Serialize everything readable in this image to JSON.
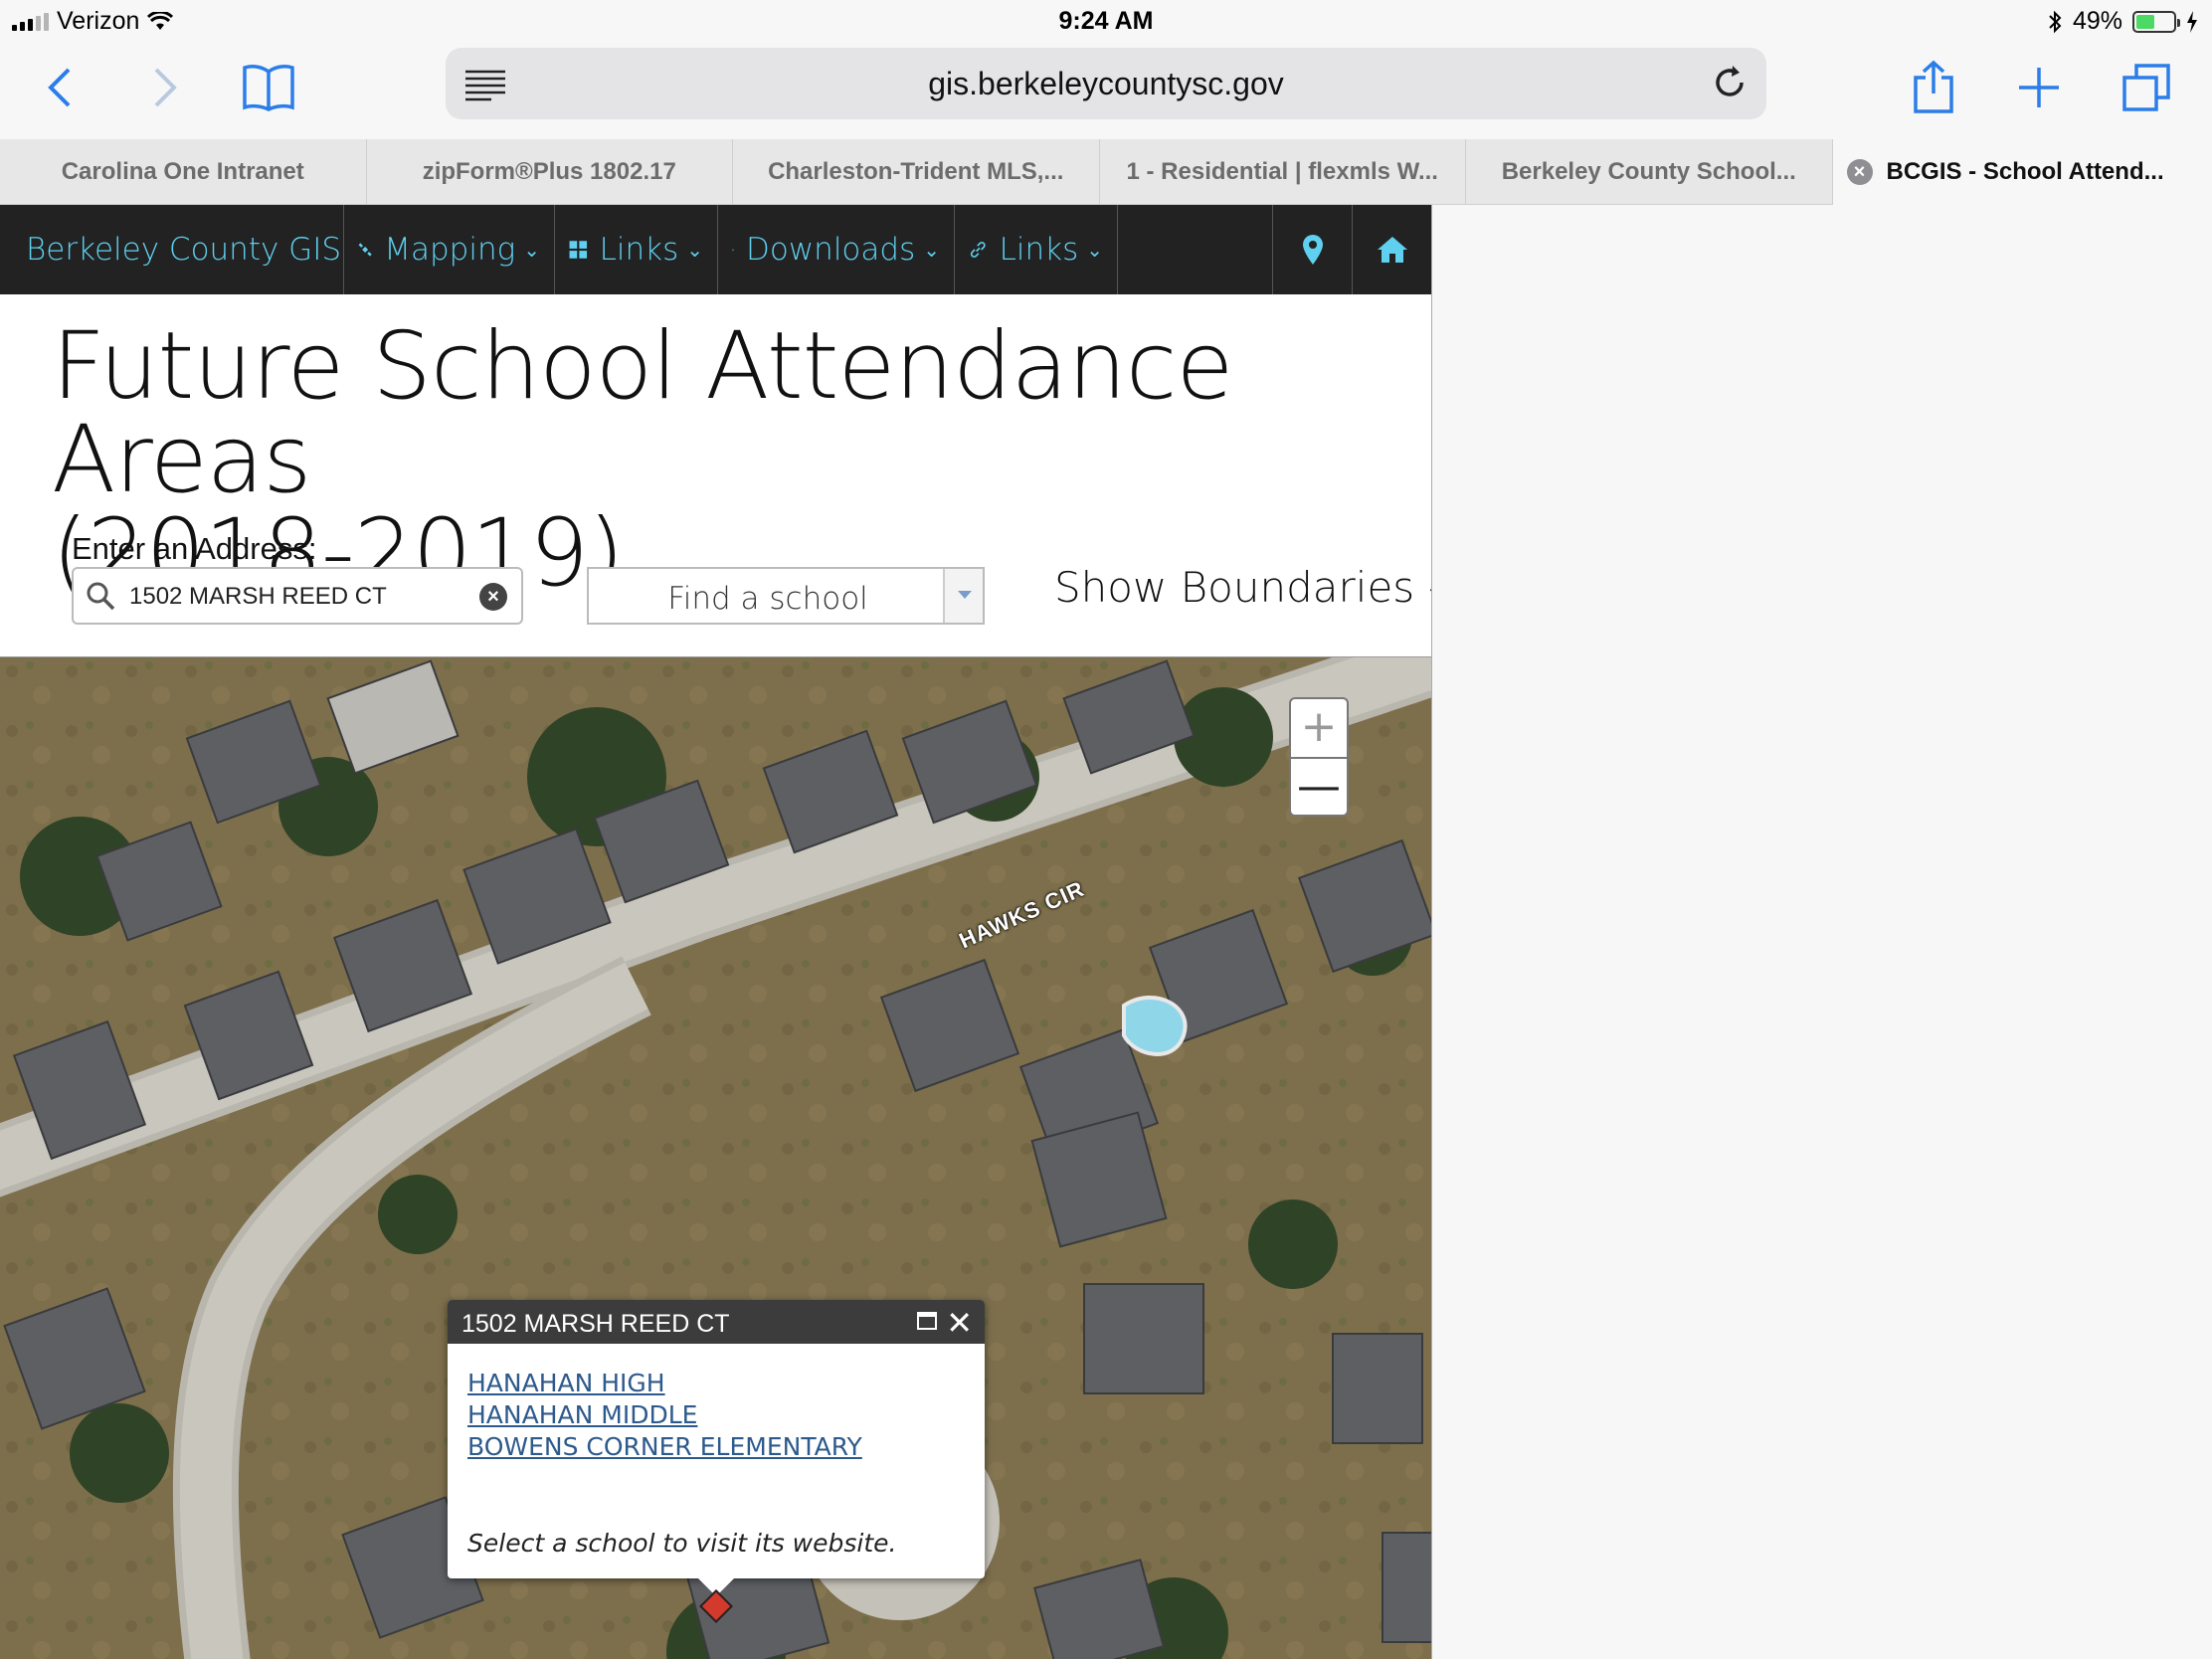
{
  "status_bar": {
    "carrier": "Verizon",
    "time": "9:24 AM",
    "battery": "49%",
    "battery_level": 0.49
  },
  "browser": {
    "url": "gis.berkeleycountysc.gov",
    "tabs": [
      {
        "label": "Carolina One Intranet"
      },
      {
        "label": "zipForm®Plus 1802.17"
      },
      {
        "label": "Charleston-Trident MLS,..."
      },
      {
        "label": "1 - Residential | flexmls W..."
      },
      {
        "label": "Berkeley County School..."
      },
      {
        "label": "BCGIS - School Attend..."
      }
    ]
  },
  "nav": {
    "brand": "Berkeley County GIS",
    "items": [
      {
        "label": "Mapping"
      },
      {
        "label": "Links"
      },
      {
        "label": "Downloads"
      },
      {
        "label": "Links"
      }
    ]
  },
  "page": {
    "title_line1": "Future School Attendance Areas",
    "title_line2": "(2018-2019)",
    "address_label": "Enter an Address:",
    "address_value": "1502 MARSH REED CT",
    "find_school": "Find a school",
    "show_boundaries": "Show Boundaries"
  },
  "map": {
    "street_label": "HAWKS CIR",
    "zoom_in": "+",
    "zoom_out": "—",
    "popup": {
      "title": "1502 MARSH REED CT",
      "schools": [
        "HANAHAN HIGH",
        "HANAHAN MIDDLE",
        "BOWENS CORNER ELEMENTARY"
      ],
      "note": "Select a school to visit its website."
    }
  }
}
